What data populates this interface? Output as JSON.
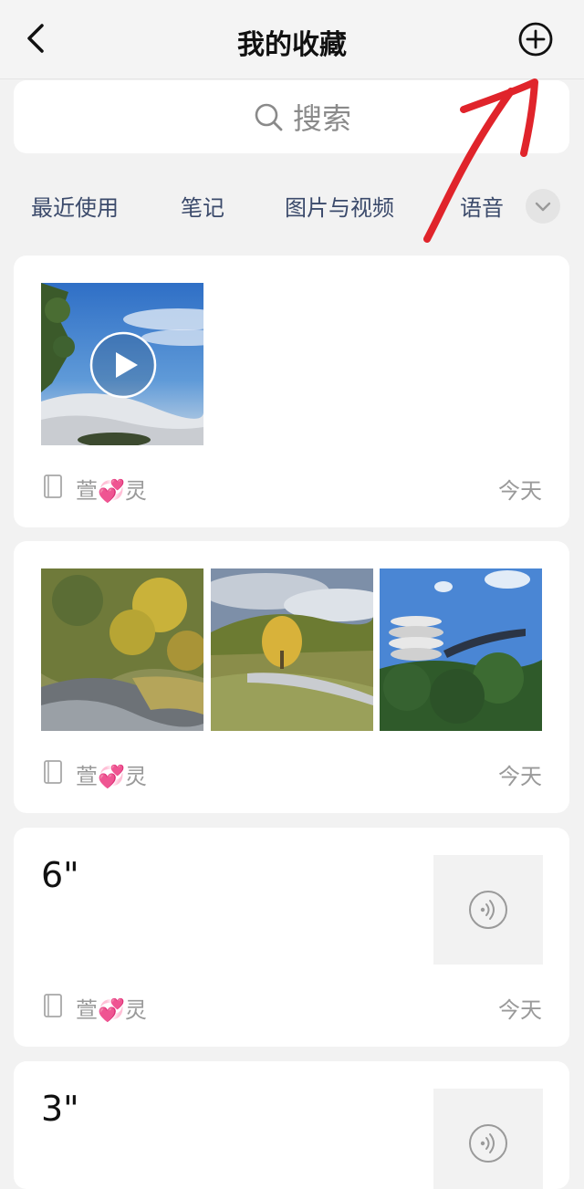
{
  "header": {
    "title": "我的收藏"
  },
  "search": {
    "placeholder": "搜索"
  },
  "categories": [
    {
      "label": "最近使用"
    },
    {
      "label": "笔记"
    },
    {
      "label": "图片与视频"
    },
    {
      "label": "语音"
    }
  ],
  "items": [
    {
      "type": "video",
      "author": "萱💞灵",
      "date": "今天"
    },
    {
      "type": "images",
      "author": "萱💞灵",
      "date": "今天"
    },
    {
      "type": "voice",
      "duration": "6\"",
      "author": "萱💞灵",
      "date": "今天"
    },
    {
      "type": "voice",
      "duration": "3\""
    }
  ],
  "colors": {
    "background": "#f2f2f2",
    "card": "#ffffff",
    "category_text": "#3b4a6b",
    "annotation_arrow": "#e0242b"
  },
  "icons": [
    "back-icon",
    "add-circle-icon",
    "search-icon",
    "chevron-down-icon",
    "play-icon",
    "book-icon",
    "voice-icon"
  ]
}
